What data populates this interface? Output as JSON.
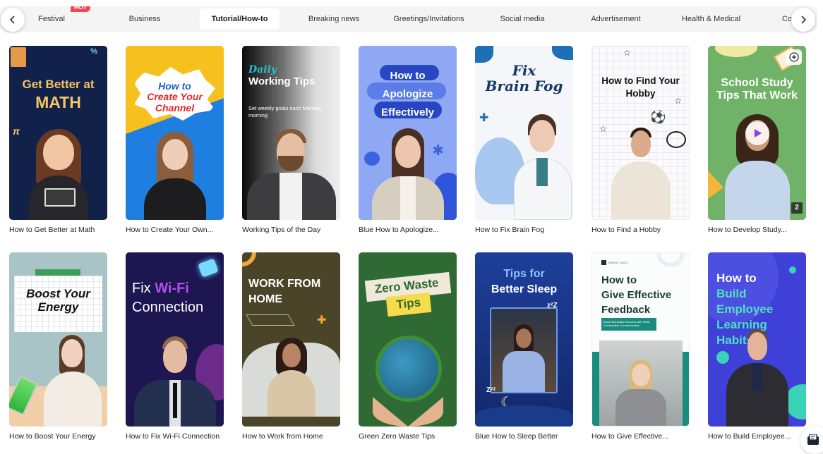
{
  "tabs": [
    {
      "label": "Festival",
      "badge": "HOT",
      "active": false
    },
    {
      "label": "Business",
      "active": false
    },
    {
      "label": "Tutorial/How-to",
      "active": true
    },
    {
      "label": "Breaking news",
      "active": false
    },
    {
      "label": "Greetings/Invitations",
      "active": false
    },
    {
      "label": "Social media",
      "active": false
    },
    {
      "label": "Advertisement",
      "active": false
    },
    {
      "label": "Health & Medical",
      "active": false
    },
    {
      "label": "Co",
      "active": false
    }
  ],
  "nav": {
    "prev_icon": "chevron-left-icon",
    "next_icon": "chevron-right-icon"
  },
  "templates": [
    {
      "caption": "How to Get Better at Math",
      "thumb_title": [
        "Get Better at",
        "MATH"
      ]
    },
    {
      "caption": "How to Create Your Own...",
      "thumb_title": [
        "How to",
        "Create Your",
        "Channel"
      ]
    },
    {
      "caption": "Working Tips of the Day",
      "thumb_title": [
        "Daily",
        "Working Tips"
      ],
      "thumb_subtitle": "Set weekly goals each Monday morning"
    },
    {
      "caption": "Blue How to Apologize...",
      "thumb_title": [
        "How to",
        "Apologize",
        "Effectively"
      ]
    },
    {
      "caption": "How to Fix Brain Fog",
      "thumb_title": [
        "Fix",
        "Brain Fog"
      ]
    },
    {
      "caption": "How to Find a Hobby",
      "thumb_title": [
        "How to Find Your",
        "Hobby"
      ]
    },
    {
      "caption": "How to Develop Study...",
      "thumb_title": [
        "School Study",
        "Tips That Work"
      ],
      "hover": true,
      "count": "2"
    },
    {
      "caption": "How to Boost Your Energy",
      "thumb_title": [
        "Boost Your",
        "Energy"
      ]
    },
    {
      "caption": "How to Fix Wi-Fi Connection",
      "thumb_title": [
        "Fix ",
        "Wi-Fi",
        "Connection"
      ]
    },
    {
      "caption": "How to Work from Home",
      "thumb_title": [
        "WORK FROM",
        "HOME"
      ]
    },
    {
      "caption": "Green Zero Waste Tips",
      "thumb_title": [
        "Zero Waste",
        "Tips"
      ]
    },
    {
      "caption": "Blue How to Sleep Better",
      "thumb_title": [
        "Tips for",
        "Better Sleep"
      ]
    },
    {
      "caption": "How to Give Effective...",
      "thumb_title": [
        "How to",
        "Give Effective",
        "Feedback"
      ],
      "thumb_logo": "INSERT LOGO",
      "thumb_subtitle": "Boost Workplace Success with Clear, Constructive Communication"
    },
    {
      "caption": "How to Build Employee...",
      "thumb_title": [
        "How to",
        "Build Employee",
        "Learning Habits"
      ]
    }
  ],
  "chat": {
    "icon": "chat-inbox-icon"
  }
}
